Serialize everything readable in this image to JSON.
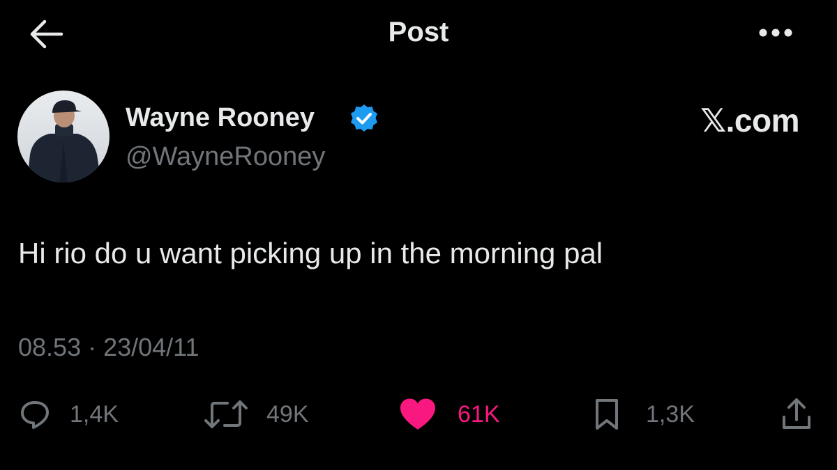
{
  "header": {
    "title": "Post",
    "back_icon": "arrow-left-icon",
    "more_icon": "more-horizontal-icon"
  },
  "author": {
    "name": "Wayne Rooney",
    "handle": "@WayneRooney",
    "verified": true,
    "verified_color": "#1d9bf0"
  },
  "brand": {
    "label": "𝕏.com"
  },
  "post": {
    "text": "Hi rio do u want picking up in the morning pal",
    "timestamp": "08.53 · 23/04/11"
  },
  "actions": {
    "replies": {
      "icon": "comment-icon",
      "count": "1,4K"
    },
    "reposts": {
      "icon": "repost-icon",
      "count": "49K"
    },
    "likes": {
      "icon": "heart-icon",
      "count": "61K",
      "liked": true,
      "color": "#f91880"
    },
    "bookmarks": {
      "icon": "bookmark-icon",
      "count": "1,3K"
    },
    "share": {
      "icon": "share-icon"
    }
  },
  "colors": {
    "background": "#000000",
    "primary_text": "#e7e9ea",
    "secondary_text": "#71767b",
    "like": "#f91880",
    "verified": "#1d9bf0"
  }
}
